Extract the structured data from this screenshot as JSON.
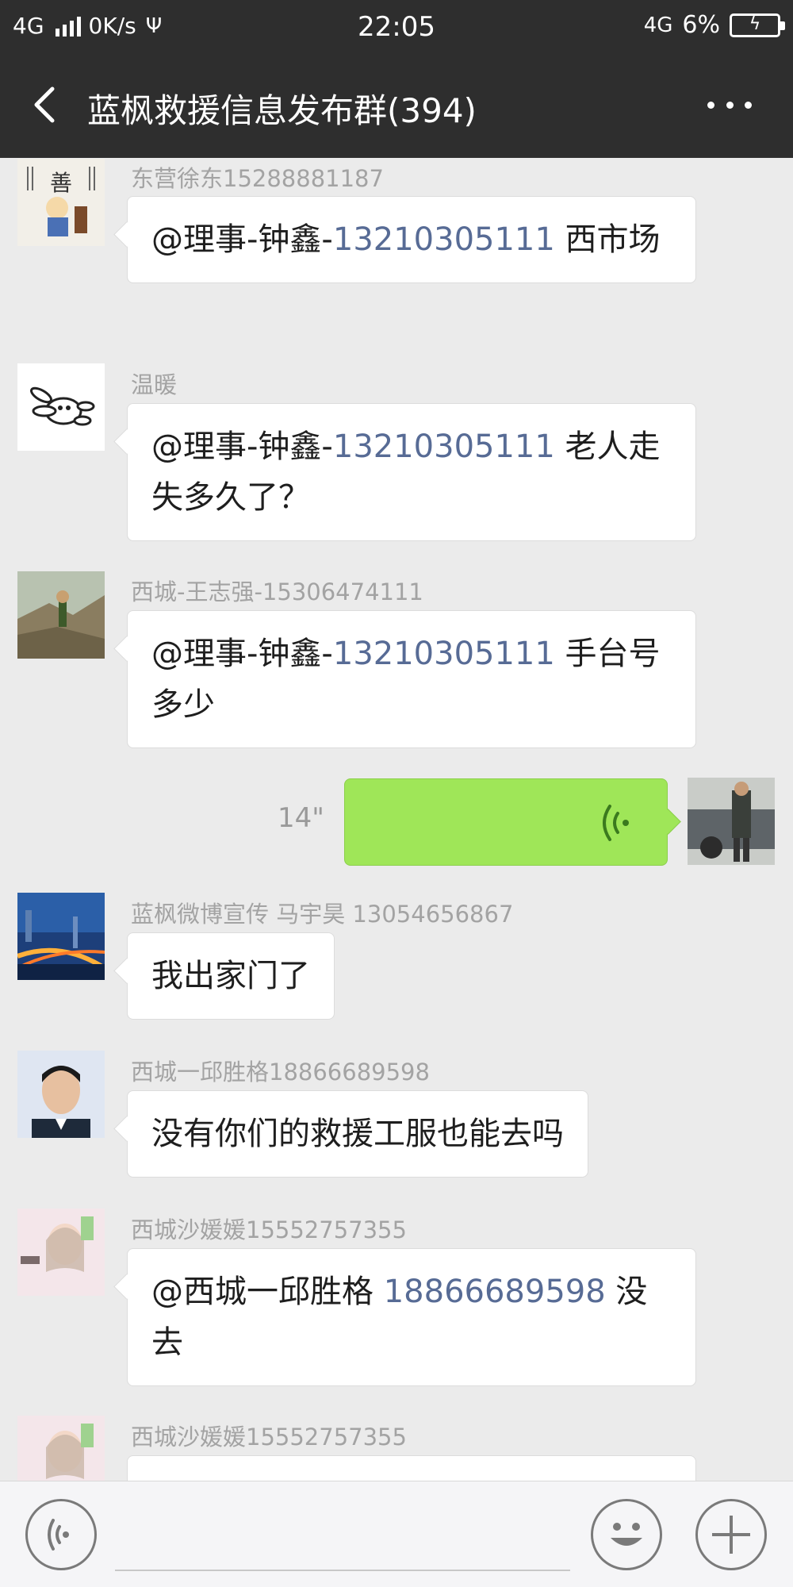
{
  "status": {
    "network": "4G",
    "speed": "0K/s",
    "time": "22:05",
    "net_right": "4G",
    "battery": "6%"
  },
  "header": {
    "title": "蓝枫救援信息发布群(394)"
  },
  "messages": [
    {
      "sender": "东营徐东15288881187",
      "prefix": "@理事-钟鑫-",
      "phone": "13210305111",
      "text": " 西市场"
    },
    {
      "sender": "温暖",
      "prefix": "@理事-钟鑫-",
      "phone": "13210305111",
      "text": " 老人走失多久了？"
    },
    {
      "sender": "西城-王志强-15306474111",
      "prefix": "@理事-钟鑫-",
      "phone": "13210305111",
      "text": " 手台号多少"
    },
    {
      "sender": "蓝枫微博宣传  马宇昊 13054656867",
      "text": "我出家门了"
    },
    {
      "sender": "西城一邱胜格18866689598",
      "text": "没有你们的救援工服也能去吗"
    },
    {
      "sender": "西城沙媛媛15552757355",
      "prefix": "@西城一邱胜格 ",
      "phone": "18866689598",
      "text": " 没去"
    },
    {
      "sender": "西城沙媛媛15552757355"
    }
  ],
  "voice_message": {
    "duration": "14\""
  },
  "icons": {
    "back": "chevron-left-icon",
    "more": "more-dots-icon",
    "voice": "voice-input-icon",
    "emoji": "emoji-icon",
    "plus": "plus-icon"
  },
  "colors": {
    "header_bg": "#2e2e2e",
    "chat_bg": "#ebebeb",
    "voice_bubble": "#9fe658",
    "link_phone": "#576b95"
  }
}
